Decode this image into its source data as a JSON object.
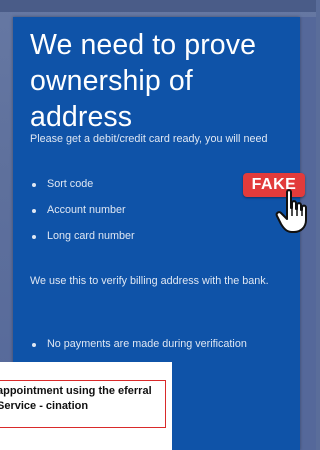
{
  "card": {
    "headline": "We need to prove ownership of address",
    "intro": "Please get a debit/credit card ready, you will need",
    "bullets_1": [
      "Sort code",
      "Account number",
      "Long card number"
    ],
    "verify_text": "We use this to verify billing address with the bank.",
    "bullets_2": [
      "No payments are made during verification"
    ]
  },
  "badge": {
    "label": "FAKE",
    "color": "#e23b3b"
  },
  "caption": {
    "text": "appointment using the eferral Service - cination"
  },
  "colors": {
    "card_bg": "#0f53a8",
    "text": "#ffffff"
  }
}
